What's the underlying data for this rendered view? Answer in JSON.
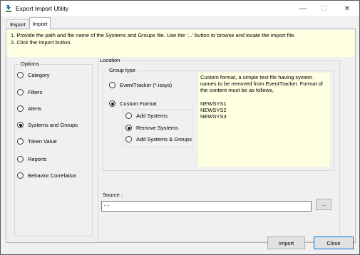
{
  "window": {
    "title": "Export Import Utility",
    "minimize_glyph": "—",
    "maximize_glyph": "☐",
    "close_glyph": "✕",
    "icon": "app-icon"
  },
  "tabs": [
    {
      "label": "Export",
      "selected": false
    },
    {
      "label": "Import",
      "selected": true
    }
  ],
  "instructions": {
    "line1": "1. Provide the path and file name of the Systems and Groups file. Use the '...' button to browse and locate the import file.",
    "line2": "2. Click the Import button."
  },
  "options": {
    "title": "Options",
    "items": [
      {
        "label": "Category",
        "checked": false
      },
      {
        "label": "Filters",
        "checked": false
      },
      {
        "label": "Alerts",
        "checked": false
      },
      {
        "label": "Systems and Groups",
        "checked": true
      },
      {
        "label": "Token Value",
        "checked": false
      },
      {
        "label": "Reports",
        "checked": false
      },
      {
        "label": "Behavior Correlation",
        "checked": false
      }
    ]
  },
  "location": {
    "title": "Location",
    "group_type": {
      "title": "Group type",
      "eventtracker_label": "EventTracker (*.issys)",
      "custom_label": "Custom Format",
      "selected": "Custom Format",
      "sub_options": [
        {
          "label": "Add Systems",
          "checked": false
        },
        {
          "label": "Remove Systems",
          "checked": true
        },
        {
          "label": "Add Systems & Groups",
          "checked": false
        }
      ]
    },
    "description": {
      "text": "Custom format, a simple text file having system names to be removed from EventTracker. Format of the content must be as follows,",
      "examples": [
        "NEWSYS1",
        "NEWSYS2",
        "NEWSYS3"
      ]
    }
  },
  "source": {
    "label": "Source :",
    "value": "- -",
    "browse_label": "..."
  },
  "buttons": {
    "import_label": "Import",
    "close_label": "Close"
  }
}
